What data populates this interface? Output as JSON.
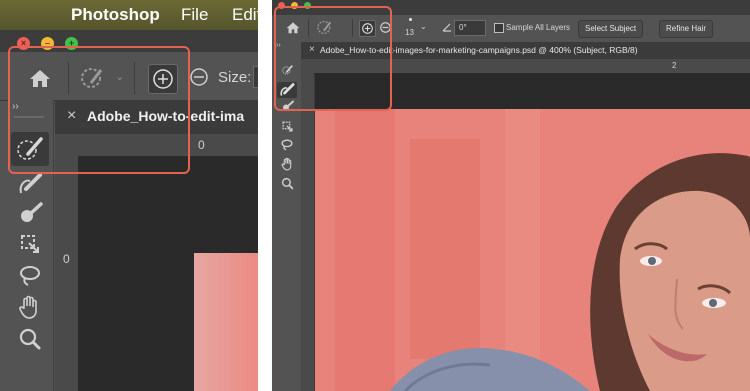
{
  "left_panel": {
    "menubar": {
      "apple_glyph": "",
      "app_name": "Photoshop",
      "menu_file": "File",
      "menu_edit": "Edit"
    },
    "traffic_lights": {
      "close": "×",
      "minimize": "–",
      "zoom": "+"
    },
    "options": {
      "size_label": "Size:"
    },
    "document": {
      "panel_toggle": "››",
      "close": "×",
      "tab_title": "Adobe_How-to-edit-ima",
      "ruler_top_zero": "0",
      "ruler_left_zero": "0"
    },
    "tools": [
      "object-selection",
      "quick-selection-brush",
      "select-subject-brush",
      "crop",
      "lasso",
      "hand",
      "zoom"
    ]
  },
  "right_panel": {
    "options": {
      "brush_size": "13",
      "angle": "0°",
      "sample_all_layers": "Sample All Layers",
      "select_subject": "Select Subject",
      "refine_hair": "Refine Hair"
    },
    "document": {
      "panel_toggle": "››",
      "close": "×",
      "tab_title": "Adobe_How-to-edit-images-for-marketing-campaigns.psd @ 400% (Subject, RGB/8)",
      "ruler_top_mark": "2"
    }
  },
  "colors": {
    "highlight": "#e2634f",
    "ui_dark": "#535353",
    "canvas": "#2a2a2a",
    "mask_overlay": "#e88179"
  }
}
